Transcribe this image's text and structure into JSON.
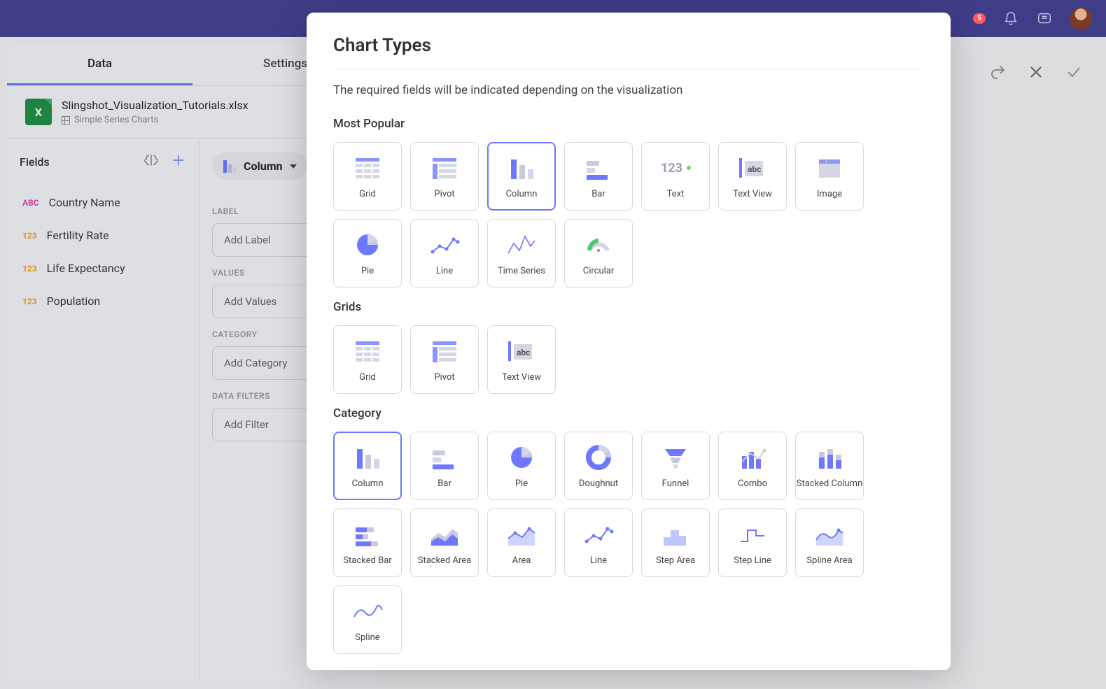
{
  "topbar": {
    "badge": "5"
  },
  "tabs": {
    "data": "Data",
    "settings": "Settings"
  },
  "file": {
    "name": "Slingshot_Visualization_Tutorials.xlsx",
    "sheet": "Simple Series Charts"
  },
  "fields_label": "Fields",
  "fields": [
    {
      "type": "ABC",
      "cls": "abc",
      "label": "Country Name"
    },
    {
      "type": "123",
      "cls": "num",
      "label": "Fertility Rate"
    },
    {
      "type": "123",
      "cls": "num",
      "label": "Life Expectancy"
    },
    {
      "type": "123",
      "cls": "num",
      "label": "Population"
    }
  ],
  "selector_label": "Column",
  "zones": {
    "label_h": "LABEL",
    "label_p": "Add Label",
    "values_h": "VALUES",
    "values_p": "Add Values",
    "category_h": "CATEGORY",
    "category_p": "Add Category",
    "filters_h": "DATA FILTERS",
    "filters_p": "Add Filter"
  },
  "modal": {
    "title": "Chart Types",
    "desc": "The required fields will be indicated depending on the visualization",
    "s1": "Most Popular",
    "s2": "Grids",
    "s3": "Category",
    "popular": [
      "Grid",
      "Pivot",
      "Column",
      "Bar",
      "Text",
      "Text View",
      "Image",
      "Pie",
      "Line",
      "Time Series",
      "Circular"
    ],
    "grids": [
      "Grid",
      "Pivot",
      "Text View"
    ],
    "category": [
      "Column",
      "Bar",
      "Pie",
      "Doughnut",
      "Funnel",
      "Combo",
      "Stacked Column",
      "Stacked Bar",
      "Stacked Area",
      "Area",
      "Line",
      "Step Area",
      "Step Line",
      "Spline Area",
      "Spline"
    ],
    "selected": "Column"
  }
}
